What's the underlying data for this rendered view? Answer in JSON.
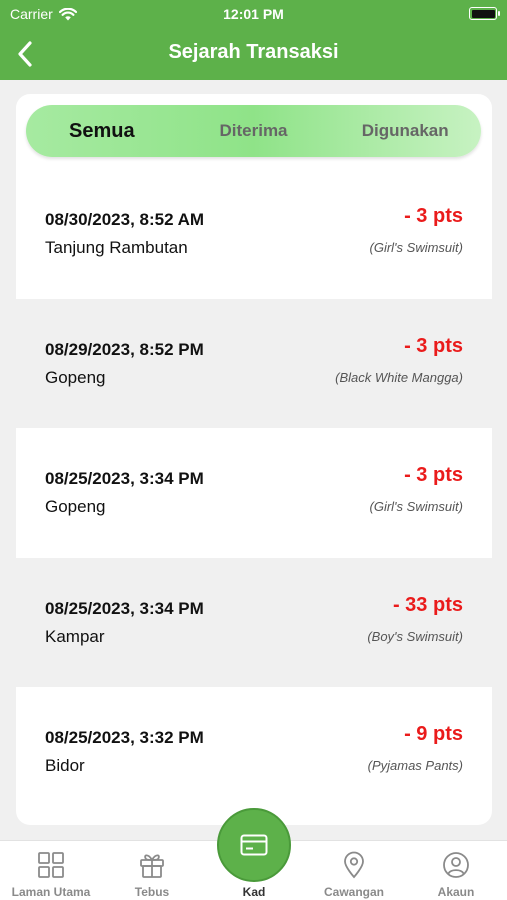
{
  "status_bar": {
    "carrier": "Carrier",
    "time": "12:01 PM"
  },
  "header": {
    "title": "Sejarah Transaksi"
  },
  "tabs": [
    {
      "label": "Semua",
      "active": true
    },
    {
      "label": "Diterima",
      "active": false
    },
    {
      "label": "Digunakan",
      "active": false
    }
  ],
  "transactions": [
    {
      "date": "08/30/2023, 8:52 AM",
      "location": "Tanjung Rambutan",
      "points": "- 3 pts",
      "item": "(Girl's Swimsuit)"
    },
    {
      "date": "08/29/2023, 8:52 PM",
      "location": "Gopeng",
      "points": "- 3 pts",
      "item": "(Black White Mangga)"
    },
    {
      "date": "08/25/2023, 3:34 PM",
      "location": "Gopeng",
      "points": "- 3 pts",
      "item": "(Girl's Swimsuit)"
    },
    {
      "date": "08/25/2023, 3:34 PM",
      "location": "Kampar",
      "points": "- 33 pts",
      "item": "(Boy's Swimsuit)"
    },
    {
      "date": "08/25/2023, 3:32 PM",
      "location": "Bidor",
      "points": "- 9 pts",
      "item": "(Pyjamas Pants)"
    }
  ],
  "tab_bar": {
    "items": [
      {
        "label": "Laman Utama",
        "icon": "grid-icon"
      },
      {
        "label": "Tebus",
        "icon": "gift-icon"
      },
      {
        "label": "Kad",
        "icon": "card-icon"
      },
      {
        "label": "Cawangan",
        "icon": "location-pin-icon"
      },
      {
        "label": "Akaun",
        "icon": "user-icon"
      }
    ]
  },
  "colors": {
    "brand_green": "#5db14a",
    "points_red": "#ea1b1b"
  }
}
